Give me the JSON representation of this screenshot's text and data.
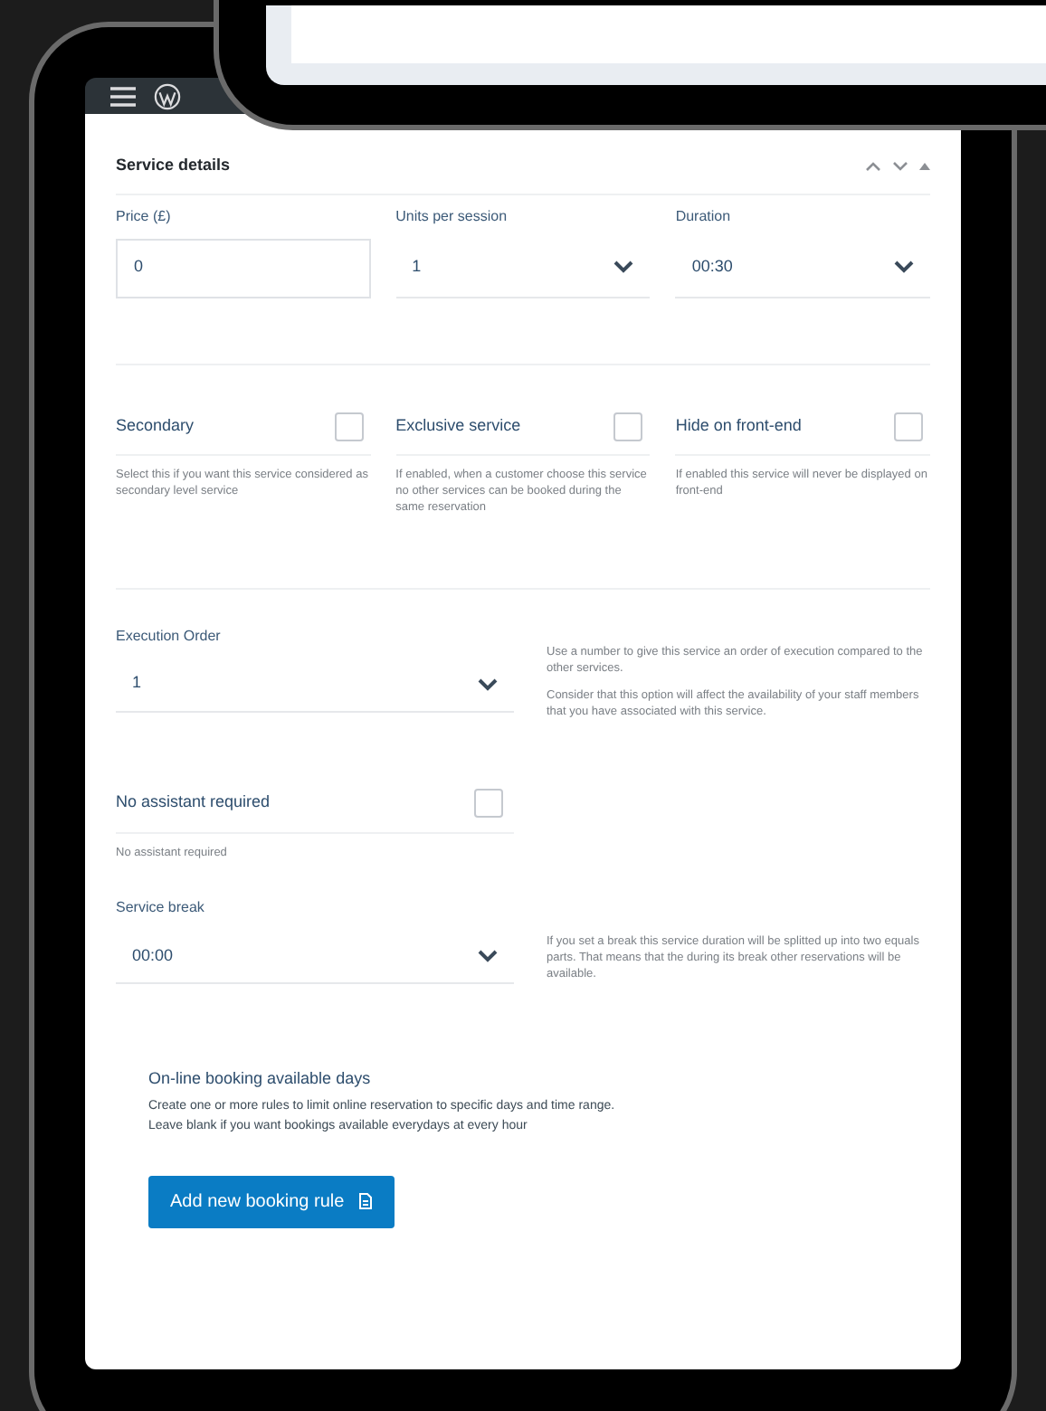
{
  "panel": {
    "title": "Service details"
  },
  "fields": [
    {
      "kind": "input",
      "label": "Price (£)",
      "value": "0"
    },
    {
      "kind": "select",
      "label": "Units per session",
      "value": "1"
    },
    {
      "kind": "select",
      "label": "Duration",
      "value": "00:30"
    }
  ],
  "options": [
    {
      "label": "Secondary",
      "checked": false,
      "description": "Select this if you want this service considered as secondary level service"
    },
    {
      "label": "Exclusive service",
      "checked": false,
      "description": "If enabled, when a customer choose this service no other services can be booked during the same reservation"
    },
    {
      "label": "Hide on front-end",
      "checked": false,
      "description": "If enabled this service will never be displayed on front-end"
    }
  ],
  "execution_order": {
    "label": "Execution Order",
    "value": "1",
    "help": [
      "Use a number to give this service an order of execution compared to the other services.",
      "Consider that this option will affect the availability of your staff members that you have associated with this service."
    ]
  },
  "no_assistant": {
    "label": "No assistant required",
    "checked": false,
    "note": "No assistant required"
  },
  "service_break": {
    "label": "Service break",
    "value": "00:00",
    "help": [
      "If you set a break this service duration will be splitted up into two equals parts. That means that the during its break other reservations will be available."
    ]
  },
  "booking": {
    "title": "On-line booking available days",
    "lines": [
      "Create one or more rules to limit online reservation to specific days and time range.",
      "Leave blank if you want bookings available everydays at every hour"
    ]
  },
  "button": {
    "label": "Add new booking rule"
  }
}
